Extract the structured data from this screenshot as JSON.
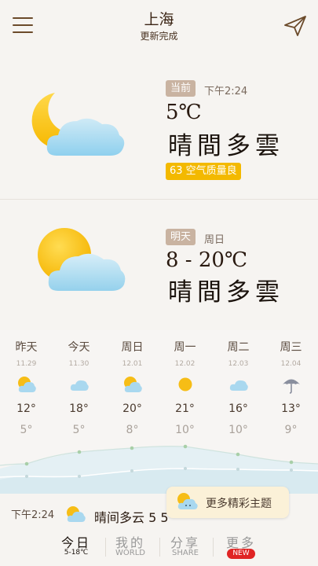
{
  "header": {
    "city": "上海",
    "update_status": "更新完成"
  },
  "current": {
    "tag": "当前",
    "time": "下午2:24",
    "temperature": "5℃",
    "condition": "晴間多雲",
    "aqi": "63 空气质量良",
    "icon": "moon-cloud-icon"
  },
  "tomorrow": {
    "tag": "明天",
    "weekday": "周日",
    "temperature": "8 - 20℃",
    "condition": "晴間多雲",
    "icon": "sun-cloud-icon"
  },
  "forecast": [
    {
      "day": "昨天",
      "date": "11.29",
      "high": "12°",
      "low": "5°",
      "icon": "sun-cloud-icon"
    },
    {
      "day": "今天",
      "date": "11.30",
      "high": "18°",
      "low": "5°",
      "icon": "cloud-icon"
    },
    {
      "day": "周日",
      "date": "12.01",
      "high": "20°",
      "low": "8°",
      "icon": "sun-cloud-icon"
    },
    {
      "day": "周一",
      "date": "12.02",
      "high": "21°",
      "low": "10°",
      "icon": "sun-icon"
    },
    {
      "day": "周二",
      "date": "12.03",
      "high": "16°",
      "low": "10°",
      "icon": "cloud-icon"
    },
    {
      "day": "周三",
      "date": "12.04",
      "high": "13°",
      "low": "9°",
      "icon": "umbrella-icon"
    }
  ],
  "status_bar": {
    "time": "下午2:24",
    "text": "晴间多云 5 5"
  },
  "popup": {
    "text": "更多精彩主题"
  },
  "tabs": [
    {
      "main": "今日",
      "sub": "5-18℃"
    },
    {
      "main": "我的",
      "sub": "WORLD"
    },
    {
      "main": "分享",
      "sub": "SHARE"
    },
    {
      "main": "更多",
      "sub": "NEW"
    }
  ],
  "colors": {
    "accent_brown": "#6b4a2a",
    "aqi_yellow": "#f3b900",
    "tag_bg": "#c9b3a1",
    "new_badge": "#e02424"
  }
}
